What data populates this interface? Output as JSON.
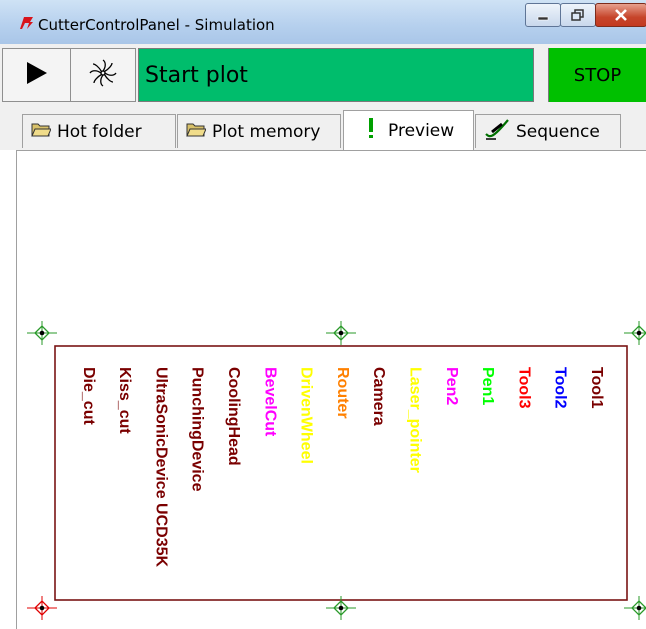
{
  "window": {
    "title": "CutterControlPanel - Simulation",
    "app_icon": "flag-logo-icon",
    "buttons": [
      "minimize-icon",
      "maximize-icon",
      "close-icon"
    ]
  },
  "toolbar": {
    "play_icon": "play-icon",
    "fan_icon": "fan-icon",
    "status_text": "Start plot",
    "status_color": "#00bd6c",
    "stop_label": "STOP",
    "stop_color": "#00c000"
  },
  "tabs": [
    {
      "label": "Hot folder",
      "icon": "folder-icon",
      "active": false
    },
    {
      "label": "Plot memory",
      "icon": "folder-icon",
      "active": false
    },
    {
      "label": "Preview",
      "icon": "marker-icon",
      "active": true
    },
    {
      "label": "Sequence",
      "icon": "pen-check-icon",
      "active": false
    }
  ],
  "preview": {
    "border_color": "#7a1414",
    "tools": [
      {
        "name": "Tool1",
        "color": "#7a0000"
      },
      {
        "name": "Tool2",
        "color": "#0000ff"
      },
      {
        "name": "Tool3",
        "color": "#ff0000"
      },
      {
        "name": "Pen1",
        "color": "#00ff00"
      },
      {
        "name": "Pen2",
        "color": "#ff00ff"
      },
      {
        "name": "Laser_pointer",
        "color": "#ffff00"
      },
      {
        "name": "Camera",
        "color": "#7a0000"
      },
      {
        "name": "Router",
        "color": "#ff8000"
      },
      {
        "name": "DrivenWheel",
        "color": "#ffff00"
      },
      {
        "name": "BevelCut",
        "color": "#ff00ff"
      },
      {
        "name": "CoolingHead",
        "color": "#7a0000"
      },
      {
        "name": "PunchingDevice",
        "color": "#7a0000"
      },
      {
        "name": "UltraSonicDevice UCD35K",
        "color": "#7a0000"
      },
      {
        "name": "Kiss_cut",
        "color": "#7a0000"
      },
      {
        "name": "Die_cut",
        "color": "#7a0000"
      }
    ]
  }
}
